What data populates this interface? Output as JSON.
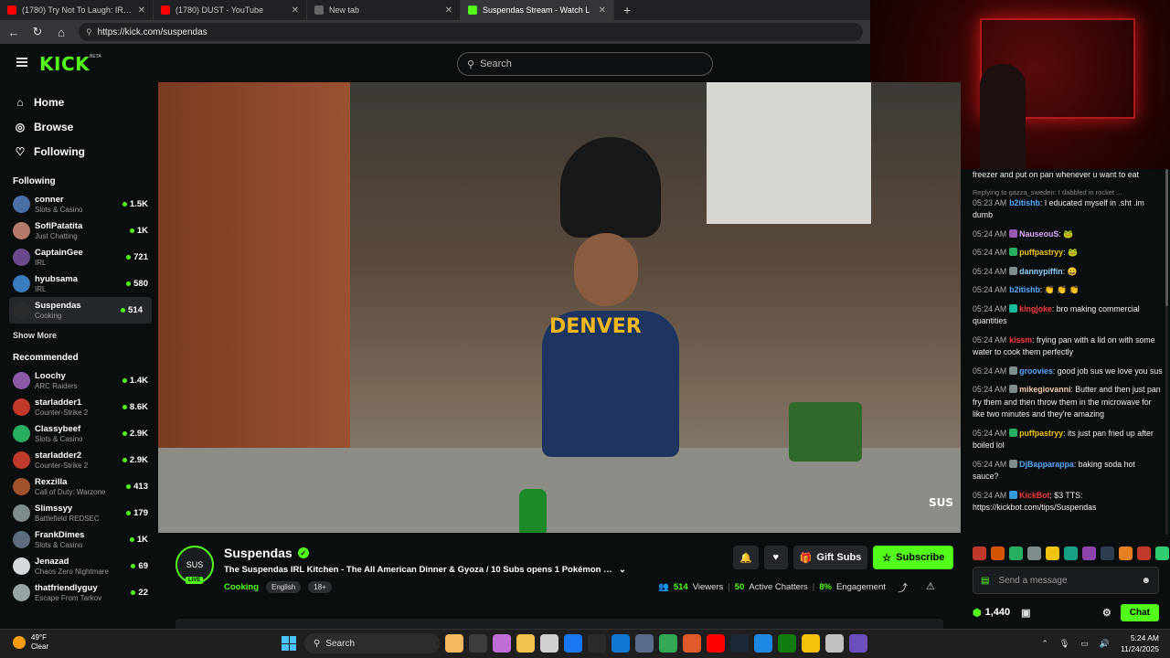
{
  "browser": {
    "tabs": [
      {
        "title": "(1780) Try Not To Laugh: IRL - Yo",
        "color": "#ff0000",
        "active": false
      },
      {
        "title": "(1780) DUST - YouTube",
        "color": "#ff0000",
        "active": false
      },
      {
        "title": "New tab",
        "color": "#666666",
        "active": false
      },
      {
        "title": "Suspendas Stream - Watch L",
        "color": "#53fc18",
        "active": true
      }
    ],
    "url": "https://kick.com/suspendas"
  },
  "kick": {
    "logo": "KICK",
    "logo_badge": "BETA",
    "search_placeholder": "Search",
    "accent": "#53fc18"
  },
  "sidebar": {
    "nav": [
      {
        "label": "Home",
        "icon": "home-icon",
        "glyph": "⌂"
      },
      {
        "label": "Browse",
        "icon": "compass-icon",
        "glyph": "◎"
      },
      {
        "label": "Following",
        "icon": "heart-icon",
        "glyph": "♡"
      }
    ],
    "following_label": "Following",
    "following": [
      {
        "name": "conner",
        "category": "Slots & Casino",
        "viewers": "1.5K",
        "color": "#4a6fa5"
      },
      {
        "name": "SofiPatatita",
        "category": "Just Chatting",
        "viewers": "1K",
        "color": "#b57a6a"
      },
      {
        "name": "CaptainGee",
        "category": "IRL",
        "viewers": "721",
        "color": "#6a4a8a"
      },
      {
        "name": "hyubsama",
        "category": "IRL",
        "viewers": "580",
        "color": "#3a7abf"
      },
      {
        "name": "Suspendas",
        "category": "Cooking",
        "viewers": "514",
        "color": "#2a2a2a"
      }
    ],
    "show_more": "Show More",
    "recommended_label": "Recommended",
    "recommended": [
      {
        "name": "Loochy",
        "category": "ARC Raiders",
        "viewers": "1.4K",
        "color": "#8a5aa5"
      },
      {
        "name": "starladder1",
        "category": "Counter-Strike 2",
        "viewers": "8.6K",
        "color": "#c0392b"
      },
      {
        "name": "Classybeef",
        "category": "Slots & Casino",
        "viewers": "2.9K",
        "color": "#27ae60"
      },
      {
        "name": "starladder2",
        "category": "Counter-Strike 2",
        "viewers": "2.9K",
        "color": "#c0392b"
      },
      {
        "name": "Rexzilla",
        "category": "Call of Duty: Warzone",
        "viewers": "413",
        "color": "#a0522d"
      },
      {
        "name": "Slimssyy",
        "category": "Battlefield REDSEC",
        "viewers": "179",
        "color": "#7f8c8d"
      },
      {
        "name": "FrankDimes",
        "category": "Slots & Casino",
        "viewers": "1K",
        "color": "#5d6d7e"
      },
      {
        "name": "Jenazad",
        "category": "Chaos Zero Nightmare",
        "viewers": "69",
        "color": "#d5d8dc"
      },
      {
        "name": "thatfriendlyguy",
        "category": "Escape From Tarkov",
        "viewers": "22",
        "color": "#95a5a6"
      }
    ]
  },
  "video": {
    "shirt_text": "DENVER",
    "watermark": "SUS"
  },
  "stream": {
    "streamer": "Suspendas",
    "avatar_text": "SUS",
    "live": "LIVE",
    "title": "The Suspendas IRL Kitchen - The All American Dinner & Gyoza / 10 Subs opens 1 Pokémon B...",
    "category": "Cooking",
    "tags": [
      "English",
      "18+"
    ],
    "viewers": "514",
    "viewers_label": "Viewers",
    "chatters": "50",
    "chatters_label": "Active Chatters",
    "engagement": "8%",
    "engagement_label": "Engagement",
    "gift_label": "Gift Subs",
    "subscribe_label": "Subscribe"
  },
  "chat": {
    "messages": [
      {
        "time": "",
        "user": "",
        "color": "#ffffff",
        "text": "freezer and put on pan whenever u want to eat",
        "badge": ""
      },
      {
        "reply": "Replying to gazza_sweden: I dabbled in rocket ...",
        "time": "05:23 AM",
        "user": "b2itishb",
        "color": "#5aa8ff",
        "text": ": I educated myself in .sht .im dumb",
        "badge": ""
      },
      {
        "time": "05:24 AM",
        "user": "NauseouS",
        "color": "#e0a8ff",
        "text": ": 🐸",
        "badge": "#9b59b6"
      },
      {
        "time": "05:24 AM",
        "user": "puffpastryy",
        "color": "#f1c40f",
        "text": ": 🐸",
        "badge": "#27ae60"
      },
      {
        "time": "05:24 AM",
        "user": "dannypiffin",
        "color": "#8fd3ff",
        "text": ": 😀",
        "badge": "#7f8c8d"
      },
      {
        "time": "05:24 AM",
        "user": "b2itishb",
        "color": "#5aa8ff",
        "text": ": 👏 👏 👏",
        "badge": ""
      },
      {
        "time": "05:24 AM",
        "user": "kingjoke",
        "color": "#ff3b3b",
        "text": ": bro making commercial quantities",
        "badge": "#1abc9c"
      },
      {
        "time": "05:24 AM",
        "user": "kissm",
        "color": "#ff3b3b",
        "text": ": frying pan with a lid on with some water to cook them perfectly",
        "badge": ""
      },
      {
        "time": "05:24 AM",
        "user": "groovies",
        "color": "#5aa8ff",
        "text": ": good job sus we love you sus",
        "badge": "#7f8c8d"
      },
      {
        "time": "05:24 AM",
        "user": "mikegiovanni",
        "color": "#f5cba7",
        "text": ": Butter and then just pan fry them and then throw them in the microwave for like two minutes and they're amazing",
        "badge": "#7f8c8d"
      },
      {
        "time": "05:24 AM",
        "user": "puffpastryy",
        "color": "#f1c40f",
        "text": ": its just pan fried up after boiled lol",
        "badge": "#27ae60"
      },
      {
        "time": "05:24 AM",
        "user": "DjBapparappa",
        "color": "#5aa8ff",
        "text": ": baking soda hot sauce?",
        "badge": "#7f8c8d"
      },
      {
        "time": "05:24 AM",
        "user": "KickBot",
        "color": "#ff3b3b",
        "text": ": $3 TTS: https://kickbot.com/tips/Suspendas",
        "badge": "#3498db"
      }
    ],
    "emote_colors": [
      "#c0392b",
      "#d35400",
      "#27ae60",
      "#7f8c8d",
      "#f1c40f",
      "#16a085",
      "#8e44ad",
      "#2c3e50",
      "#e67e22",
      "#c0392b",
      "#2ecc71",
      "#f39c12"
    ],
    "input_placeholder": "Send a message",
    "points": "1,440",
    "chat_button": "Chat"
  },
  "taskbar": {
    "temp": "49°F",
    "condition": "Clear",
    "search_label": "Search",
    "time": "5:24 AM",
    "date": "11/24/2025",
    "app_colors": [
      "#f4b860",
      "#3d3d3d",
      "#c06dd7",
      "#f2c14e",
      "#d0d0d0",
      "#1877f2",
      "#2b2b2b",
      "#0f78d4",
      "#5a6b8a",
      "#34a853",
      "#e05a2a",
      "#ff0000",
      "#1b2838",
      "#1e88e5",
      "#107c10",
      "#f4c20d",
      "#c0c0c0",
      "#6b4fbb"
    ]
  }
}
